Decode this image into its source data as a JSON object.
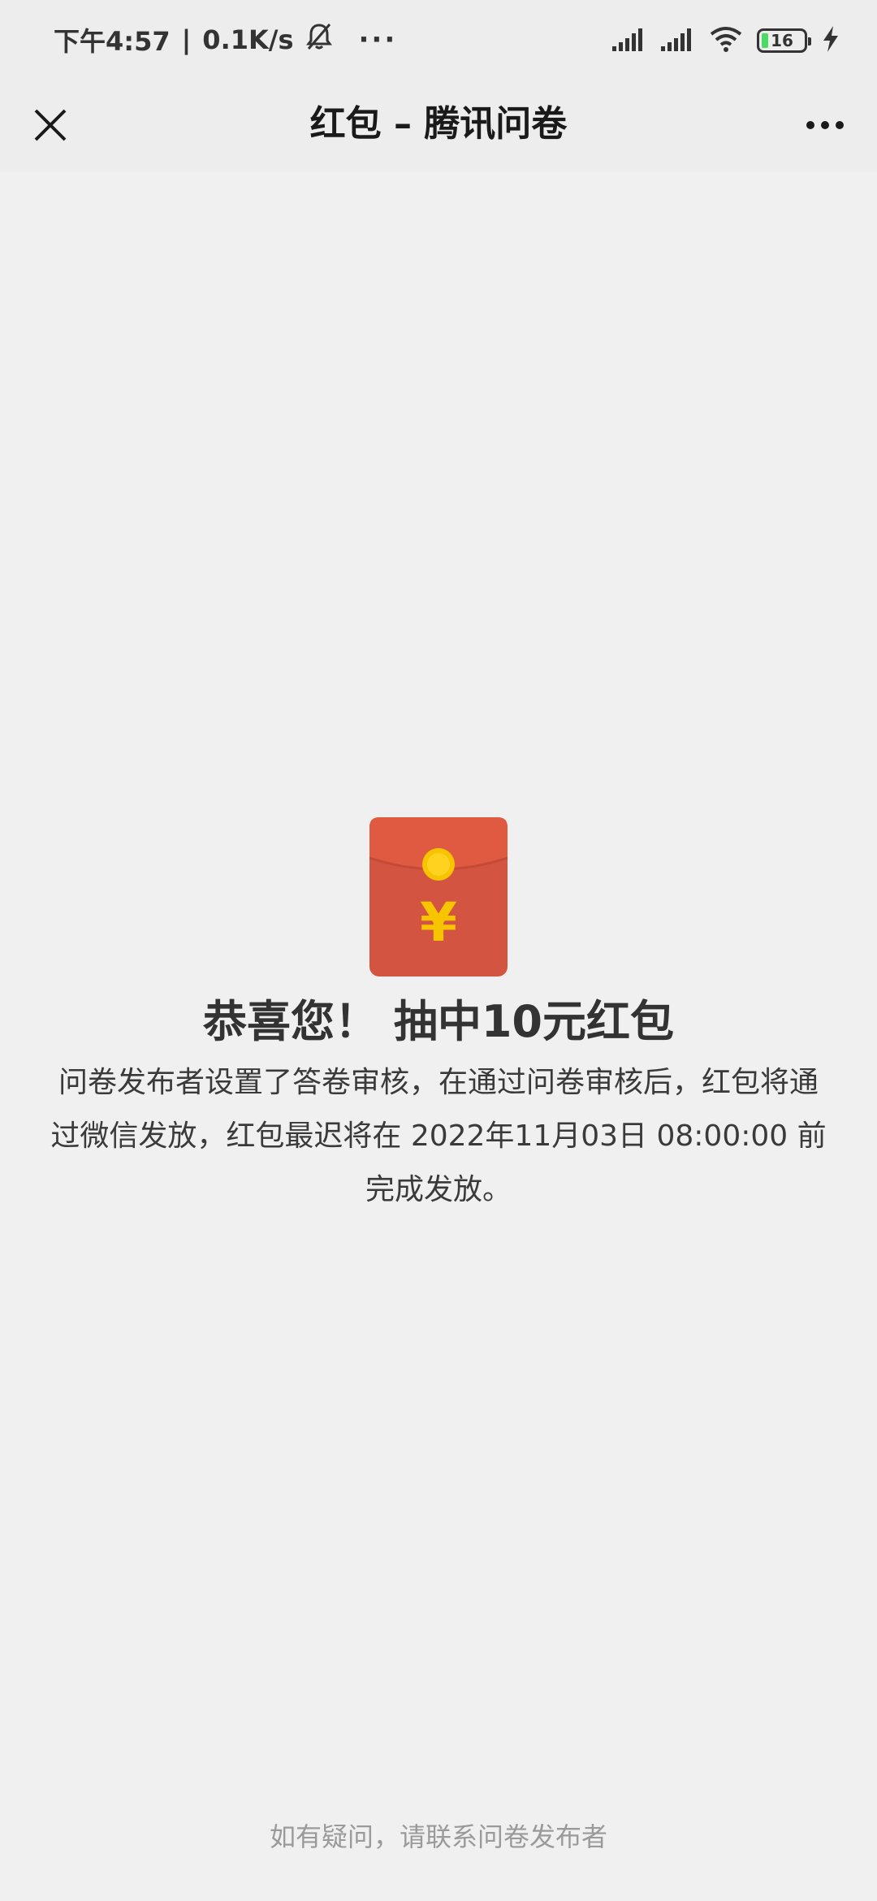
{
  "status_bar": {
    "time": "下午4:57",
    "separator": "|",
    "network_speed": "0.1K/s",
    "more": "···",
    "battery_level": "16",
    "icons": [
      "bell-off-icon",
      "signal-icon",
      "signal-icon",
      "wifi-icon",
      "battery-icon",
      "charging-icon"
    ]
  },
  "nav": {
    "title": "红包 – 腾讯问卷",
    "close_icon": "close-icon",
    "more_icon": "more-icon"
  },
  "content": {
    "envelope_icon": "red-envelope-icon",
    "yuan_symbol": "¥",
    "headline": "恭喜您！ 抽中10元红包",
    "message": "问卷发布者设置了答卷审核，在通过问卷审核后，红包将通过微信发放，红包最迟将在 2022年11月03日 08:00:00 前完成发放。"
  },
  "footer": {
    "note": "如有疑问，请联系问卷发布者"
  },
  "colors": {
    "envelope_red": "#d35440",
    "envelope_top": "#e05a42",
    "coin_gold": "#f7c500",
    "background": "#f0f0f0"
  }
}
